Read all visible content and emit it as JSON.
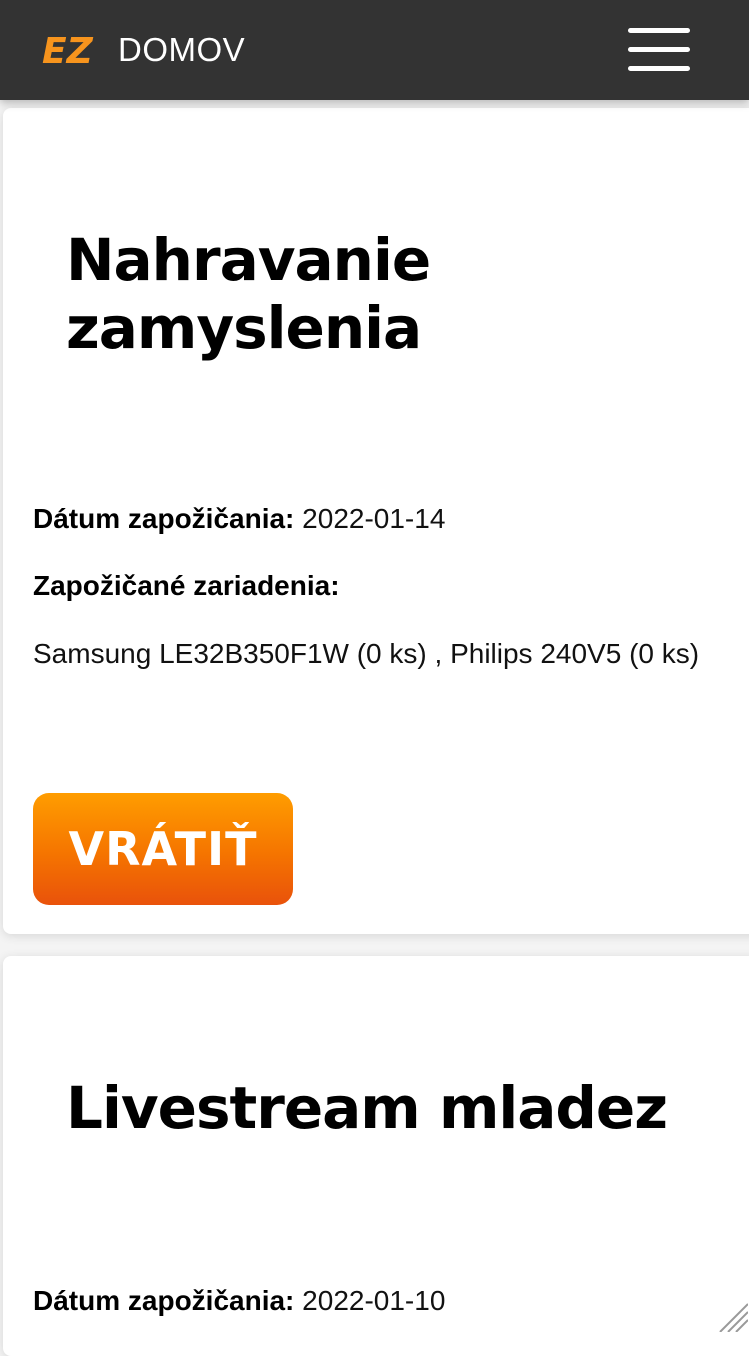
{
  "header": {
    "logo_text": "EZ",
    "logo_icon": "ez-logo-icon",
    "home_label": "DOMOV",
    "menu_icon": "hamburger-menu-icon"
  },
  "colors": {
    "header_bg": "#333333",
    "logo_orange": "#f7941d",
    "button_gradient_top": "#ff9d00",
    "button_gradient_bottom": "#e9520b"
  },
  "rentals": [
    {
      "title": "Nahravanie zamyslenia",
      "date_label": "Dátum zapožičania:",
      "date_value": "2022-01-14",
      "devices_label": "Zapožičané zariadenia:",
      "devices_value": "Samsung LE32B350F1W (0 ks) , Philips 240V5 (0 ks)",
      "return_label": "VRÁTIŤ"
    },
    {
      "title": "Livestream mladez",
      "date_label": "Dátum zapožičania:",
      "date_value": "2022-01-10"
    }
  ]
}
